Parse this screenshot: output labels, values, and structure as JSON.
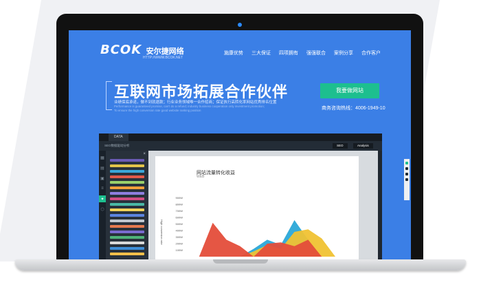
{
  "site": {
    "logo_text": "BCOK",
    "logo_cn": "安尔捷网络",
    "logo_url": "HTTP://WWW.BCOK.NET",
    "nav": [
      "施康优势",
      "三大保证",
      "四项拥有",
      "强强联合",
      "案例分享",
      "合作客户"
    ],
    "hero_title": "互联网市场拓展合作伙伴",
    "hero_sub": "业绩保底承诺，做不到就退款；行业业务领域唯一合作招商；保证执行高转化率网站优秀排名位置",
    "hero_en": [
      "Performance is guaranteed promise, can't do a refund; industry business cooperation only investment promotion;",
      "To ensure the high conversion rate good website ranking position"
    ],
    "cta": "我要做网站",
    "phone": "商务咨询热线：4006-1949-10"
  },
  "app": {
    "tab": "DATA",
    "bar_title": "SEO数据驱动分析",
    "buttons": [
      "SEO",
      "Analysis"
    ],
    "close": "×",
    "side_icons": [
      "grid-icon",
      "chart-icon",
      "image-icon",
      "layers-icon",
      "settings-icon",
      "share-icon"
    ],
    "swatch_colors": [
      "#6b5bb5",
      "#e3c44a",
      "#3aa7d9",
      "#e15a4a",
      "#9ad06b",
      "#f2a03b",
      "#8e7fe0",
      "#d04f85",
      "#4ab8a6",
      "#f0d25a",
      "#5b84e0",
      "#c0c7cf",
      "#e57a4f",
      "#7a6bd0",
      "#4fb37a",
      "#d9d9d9",
      "#3f8fd8",
      "#f3bf4a"
    ]
  },
  "chart_data": {
    "type": "area",
    "title": "网站流量转化收益",
    "subtitle": "WEB",
    "ylabel": "High conversion rate",
    "yticks": [
      "900W",
      "800W",
      "700W",
      "600W",
      "500W",
      "400W",
      "300W",
      "200W",
      "100W"
    ],
    "ylim": [
      0,
      950
    ],
    "series": [
      {
        "color": "#2aa8d8",
        "values": [
          0,
          0,
          0,
          0,
          0,
          120,
          260,
          180,
          560,
          260,
          0,
          0
        ]
      },
      {
        "color": "#f0c233",
        "values": [
          0,
          0,
          0,
          0,
          0,
          80,
          180,
          120,
          380,
          420,
          280,
          0
        ]
      },
      {
        "color": "#e44d3a",
        "values": [
          0,
          0,
          520,
          260,
          160,
          0,
          200,
          220,
          160,
          260,
          0,
          0
        ]
      }
    ]
  }
}
